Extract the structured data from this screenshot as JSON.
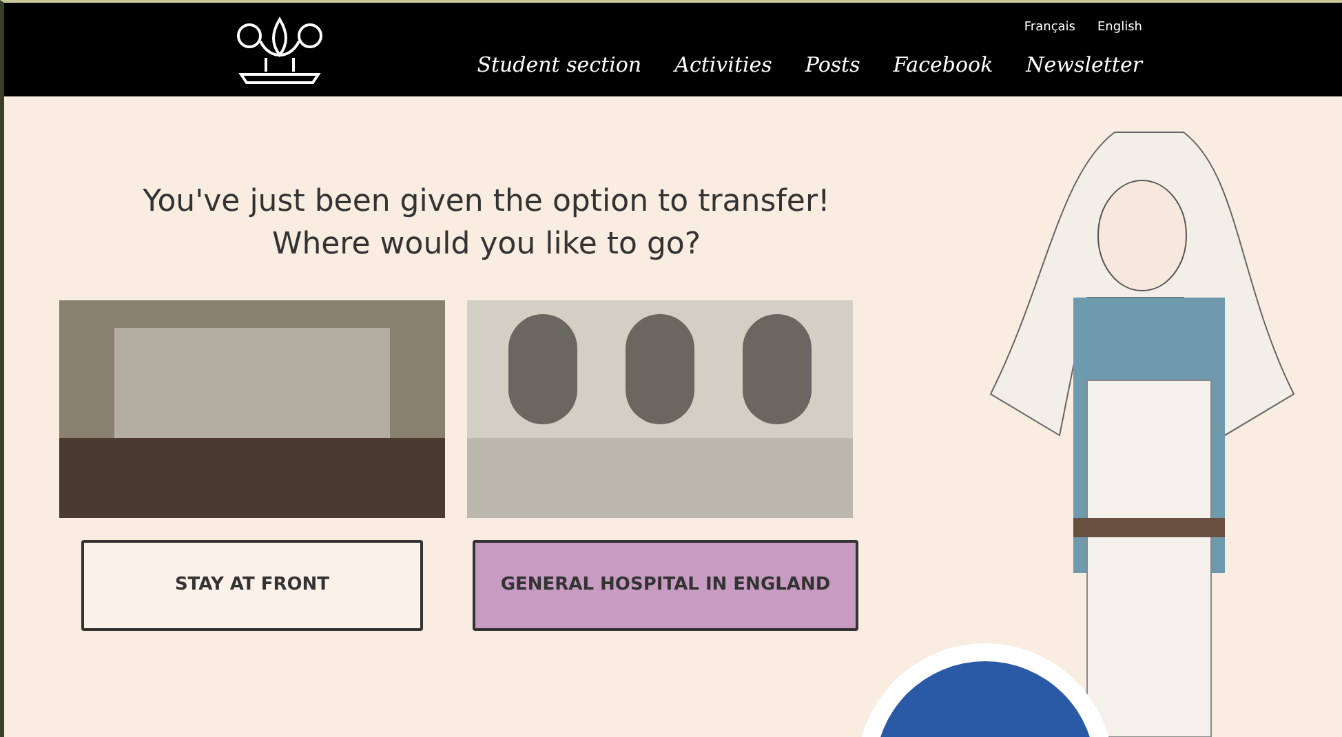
{
  "header": {
    "languages": [
      "Français",
      "English"
    ],
    "nav": [
      "Student section",
      "Activities",
      "Posts",
      "Facebook",
      "Newsletter"
    ]
  },
  "prompt": "You've just been given the option to transfer!\nWhere would you like to go?",
  "choices": [
    {
      "label": "STAY AT FRONT",
      "selected": false
    },
    {
      "label": "GENERAL HOSPITAL IN ENGLAND",
      "selected": true
    }
  ]
}
